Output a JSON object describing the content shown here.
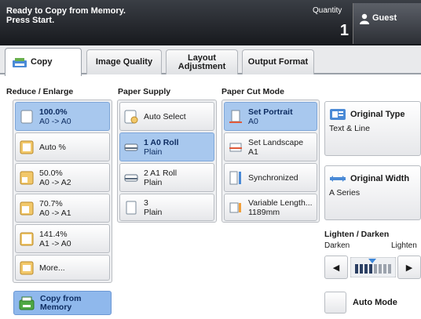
{
  "header": {
    "status_line1": "Ready to Copy from Memory.",
    "status_line2": "Press Start.",
    "quantity_label": "Quantity",
    "quantity_value": "1",
    "guest_label": "Guest"
  },
  "tabs": [
    {
      "label": "Copy",
      "active": true
    },
    {
      "label": "Image Quality"
    },
    {
      "label_line1": "Layout",
      "label_line2": "Adjustment"
    },
    {
      "label": "Output Format"
    }
  ],
  "reduce_enlarge": {
    "label": "Reduce / Enlarge",
    "options": [
      {
        "l1": "100.0%",
        "l2": "A0 -> A0",
        "selected": true
      },
      {
        "l1": "Auto %",
        "l2": ""
      },
      {
        "l1": "50.0%",
        "l2": "A0 -> A2"
      },
      {
        "l1": "70.7%",
        "l2": "A0 -> A1"
      },
      {
        "l1": "141.4%",
        "l2": "A1 -> A0"
      },
      {
        "l1": "More...",
        "l2": ""
      }
    ]
  },
  "paper_supply": {
    "label": "Paper Supply",
    "options": [
      {
        "l1": "Auto Select",
        "l2": ""
      },
      {
        "l1": "1 A0 Roll",
        "l2": "Plain",
        "selected": true
      },
      {
        "l1": "2 A1 Roll",
        "l2": "Plain"
      },
      {
        "l1": "3",
        "l2": "Plain"
      }
    ]
  },
  "paper_cut_mode": {
    "label": "Paper Cut Mode",
    "options": [
      {
        "l1": "Set Portrait",
        "l2": "A0",
        "selected": true
      },
      {
        "l1": "Set Landscape",
        "l2": "A1"
      },
      {
        "l1": "Synchronized",
        "l2": ""
      },
      {
        "l1": "Variable Length...",
        "l2": "1189mm"
      }
    ]
  },
  "copy_from_memory": {
    "l1": "Copy from",
    "l2": "Memory"
  },
  "original_type": {
    "title": "Original Type",
    "value": "Text & Line"
  },
  "original_width": {
    "title": "Original Width",
    "value": "A Series"
  },
  "lighten_darken": {
    "label": "Lighten / Darken",
    "darken": "Darken",
    "lighten": "Lighten",
    "level": 0.4,
    "left_arrow": "◀",
    "right_arrow": "▶"
  },
  "auto_mode": {
    "label": "Auto Mode"
  },
  "colors": {
    "selected": "#a8c8ee",
    "header": "#1e2025",
    "accent": "#3d86d8"
  },
  "icons": [
    "user-icon",
    "copier-icon",
    "reduce-icon",
    "paper-tray-icon",
    "cut-icon",
    "document-icon",
    "width-icon"
  ]
}
